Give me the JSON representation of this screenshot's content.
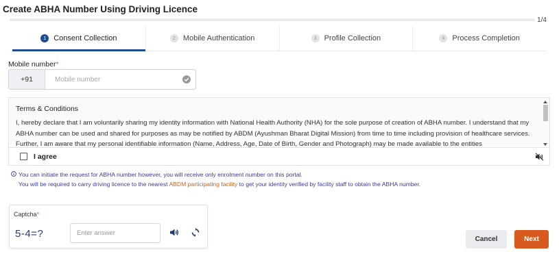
{
  "page": {
    "title": "Create ABHA Number Using Driving Licence",
    "progress_text": "1/4",
    "progress_fraction": 0.25
  },
  "steps": [
    {
      "number": "1",
      "label": "Consent Collection",
      "active": true
    },
    {
      "number": "2",
      "label": "Mobile Authentication",
      "active": false
    },
    {
      "number": "3",
      "label": "Profile Collection",
      "active": false
    },
    {
      "number": "4",
      "label": "Process Completion",
      "active": false
    }
  ],
  "mobile": {
    "label": "Mobile number",
    "required_mark": "*",
    "prefix": "+91",
    "placeholder": "Mobile number",
    "value": "",
    "status_icon": "check-circle-icon"
  },
  "terms": {
    "title": "Terms & Conditions",
    "body": "I, hereby declare that I am voluntarily sharing my identity information with National Health Authority (NHA) for the sole purpose of creation of ABHA number. I understand that my ABHA number can be used and shared for purposes as may be notified by ABDM (Ayushman Bharat Digital Mission) from time to time including provision of healthcare services. Further, I am aware that my personal identifiable information (Name, Address, Age, Date of Birth, Gender and Photograph) may be made available to the entities"
  },
  "agree": {
    "label": "I agree",
    "checked": false,
    "audio_icon": "speaker-mute-icon"
  },
  "info": {
    "icon": "info-icon",
    "line1": "You can initiate the request for ABHA number however, you will receive only enrolment number on this portal.",
    "line2_before": "You will be required to carry driving licence to the nearest",
    "line2_link": "ABDM participating facility",
    "line2_after": "to get your identity verified by facility staff to obtain the ABHA number."
  },
  "captcha": {
    "label": "Captcha",
    "required_mark": "*",
    "challenge": "5-4=?",
    "placeholder": "Enter answer",
    "value": "",
    "speaker_icon": "speaker-icon",
    "refresh_icon": "refresh-icon"
  },
  "actions": {
    "cancel_label": "Cancel",
    "next_label": "Next"
  },
  "colors": {
    "primary": "#1f4e8c",
    "accent": "#d85a1e",
    "info_text": "#3a3aa8",
    "link": "#c8641e",
    "required": "#d9534f"
  }
}
